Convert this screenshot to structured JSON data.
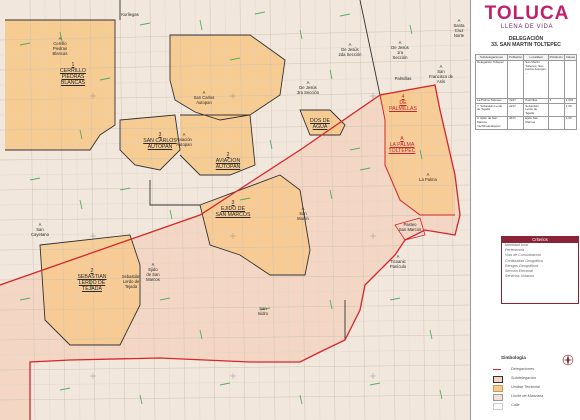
{
  "header": {
    "brand": "TOLUCA",
    "tagline": "LLENA DE VIDA",
    "delegation_title": "DELEGACIÓN",
    "delegation_name": "33. SAN MARTIN TOLTEPEC"
  },
  "info_table": {
    "headers": [
      "Subdelegaciones",
      "Población",
      "Localidad",
      "Población",
      "Claves"
    ],
    "rows": [
      [
        "Delegación Toltepec",
        "",
        "San Martin Toltepec, San Carlos Autopan, ...",
        "",
        ""
      ],
      [
        "La Palma Toltepec",
        "2247",
        "Palmillas",
        "4",
        "1.001"
      ],
      [
        "7. Sebastián Lerdo de Tejada",
        "2217",
        "Sebastián Lerdo de Tejada",
        "",
        "1.00"
      ],
      [
        "3. Ejido de San Marcos Yachihuacaltepec",
        "4671",
        "Ejido San Marcos",
        "",
        "1.00"
      ]
    ]
  },
  "map_labels": [
    {
      "id": "kuriegaas",
      "text": "Kurliegas",
      "style": "normal"
    },
    {
      "id": "cerrillo-piedras-blancas-a",
      "text": "A\nCerrillo\nPiedras\nBlancas",
      "style": "normal"
    },
    {
      "id": "cerrillo-piedras-blancas",
      "text": "1\nCERRILLO\nPIEDRAS\nBLANCAS",
      "style": "ul"
    },
    {
      "id": "san-carlos-autopan-a",
      "text": "A\nSan Carlos\nAutopan",
      "style": "normal"
    },
    {
      "id": "san-carlos-autopan",
      "text": "3\nSAN CARLOS\nAUTOPAN",
      "style": "ul"
    },
    {
      "id": "aviacion-autopan-a",
      "text": "A\nAviación\nAutopan",
      "style": "normal"
    },
    {
      "id": "aviacion-autopan",
      "text": "2\nAVIACION\nAUTOPAN",
      "style": "ul"
    },
    {
      "id": "de-jesus-3ra",
      "text": "A\nDe Jesús\n3ra Sección",
      "style": "normal"
    },
    {
      "id": "de-jesus-2da",
      "text": "A\nDe Jesús\n2da Sección",
      "style": "normal"
    },
    {
      "id": "de-jesus-1ra",
      "text": "A\nDe Jesús\n1ra\nSección",
      "style": "normal"
    },
    {
      "id": "santa-cruz-norte",
      "text": "A\nSanta\nCruz\nNorte",
      "style": "normal"
    },
    {
      "id": "palmillas-a",
      "text": "Palmillas",
      "style": "normal"
    },
    {
      "id": "palmillas",
      "text": "4\nDE\nPALMILLAS",
      "style": "red-ul"
    },
    {
      "id": "san-francisco-de-asis",
      "text": "A\nSan\nFrancisco de\nAsís",
      "style": "normal"
    },
    {
      "id": "dos-de-agua",
      "text": "DOS DE\nAGUA",
      "style": "ul"
    },
    {
      "id": "la-palma-toltepec",
      "text": "A\nLA PALMA\nTOLTEPEC",
      "style": "red-ul"
    },
    {
      "id": "la-palma",
      "text": "A\nLa Palma",
      "style": "normal"
    },
    {
      "id": "ejido-san-marcos",
      "text": "3\nEJIDO DE\nSAN MARCOS",
      "style": "ul"
    },
    {
      "id": "san-martin",
      "text": "A\nSan\nMartin",
      "style": "normal"
    },
    {
      "id": "san-cayetano",
      "text": "A\nSan\nCayetano",
      "style": "normal"
    },
    {
      "id": "lerdo-de-tejada",
      "text": "2\nSEBASTIAN\nLERDO DE\nTEJADA",
      "style": "ul"
    },
    {
      "id": "lerdo-de-tejada-a",
      "text": "Sebastián\nLerdo de\nTejada",
      "style": "normal"
    },
    {
      "id": "ejido-san-marcos-a",
      "text": "A\nEjido\nde San\nMarcos",
      "style": "normal"
    },
    {
      "id": "pasteo-san-marcos",
      "text": "Pasteo\nSan Marcos",
      "style": "normal"
    },
    {
      "id": "ticoanic-paniculo",
      "text": "A\nTicoanic\nPanículo",
      "style": "normal"
    },
    {
      "id": "san-isidro",
      "text": "San\nIsidro",
      "style": "normal"
    }
  ],
  "criteria": {
    "title": "Criterios",
    "items": [
      "Identidad local",
      "Pertenencia",
      "Vías de Comunicación",
      "Continuidad Geográfica",
      "Riesgos Geográficos",
      "Sección Electoral",
      "Servicios Urbanos"
    ]
  },
  "legend": {
    "title": "Simbología",
    "items": [
      {
        "label": "Delegaciones",
        "color": "#d6262a"
      },
      {
        "label": "Subdelegación",
        "color": "#333333"
      },
      {
        "label": "Unidad Territorial",
        "color": "#f7c98b"
      },
      {
        "label": "Límite de Manzana",
        "color": "#9a9a9a"
      },
      {
        "label": "Calle",
        "color": "#cccccc"
      }
    ]
  },
  "colors": {
    "brand": "#c3206b",
    "delegation_border": "#d6262a",
    "unit_fill": "#f7c98b",
    "base_fill": "#efe3d6",
    "street_label": "#2fa24a"
  }
}
